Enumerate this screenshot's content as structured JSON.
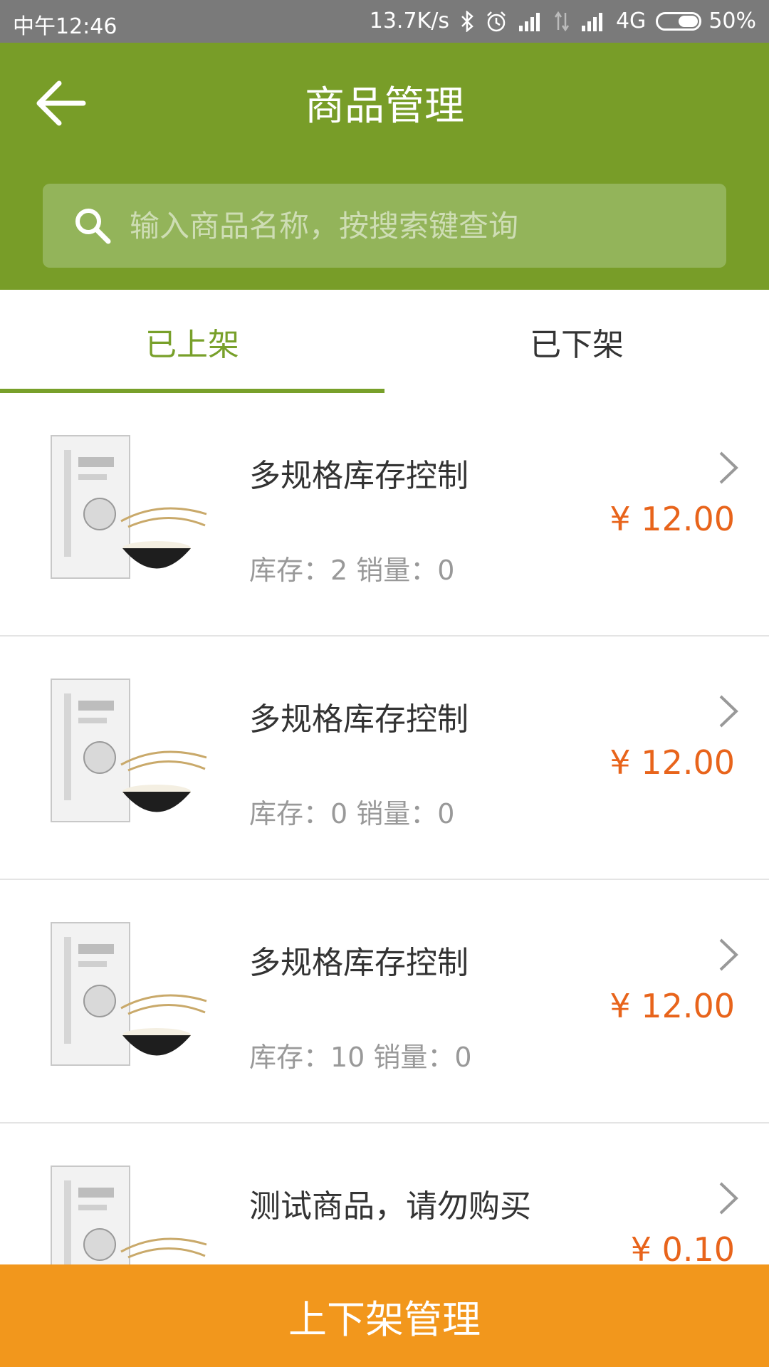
{
  "status_bar": {
    "time": "中午12:46",
    "net_speed": "13.7K/s",
    "network_type": "4G",
    "battery": "50%",
    "battery_level": 0.5,
    "icons": [
      "bluetooth-icon",
      "alarm-icon",
      "signal-icon",
      "data-transfer-icon",
      "signal-icon"
    ]
  },
  "header": {
    "title": "商品管理",
    "back_icon": "arrow-left-icon",
    "search_placeholder": "输入商品名称，按搜索键查询",
    "search_icon": "search-icon",
    "background": "#789d28"
  },
  "tabs": [
    {
      "label": "已上架",
      "active": true
    },
    {
      "label": "已下架",
      "active": false
    }
  ],
  "products": [
    {
      "name": "多规格库存控制",
      "stats": "库存：2 销量：0",
      "price": "¥ 12.00"
    },
    {
      "name": "多规格库存控制",
      "stats": "库存：0 销量：0",
      "price": "¥ 12.00"
    },
    {
      "name": "多规格库存控制",
      "stats": "库存：10 销量：0",
      "price": "¥ 12.00"
    },
    {
      "name": "测试商品，请勿购买",
      "stats": "",
      "price": "¥ 0.10"
    }
  ],
  "bottom_button": {
    "label": "上下架管理",
    "color": "#f2971c"
  },
  "colors": {
    "accent_green": "#78a02a",
    "price_orange": "#e8641b"
  }
}
